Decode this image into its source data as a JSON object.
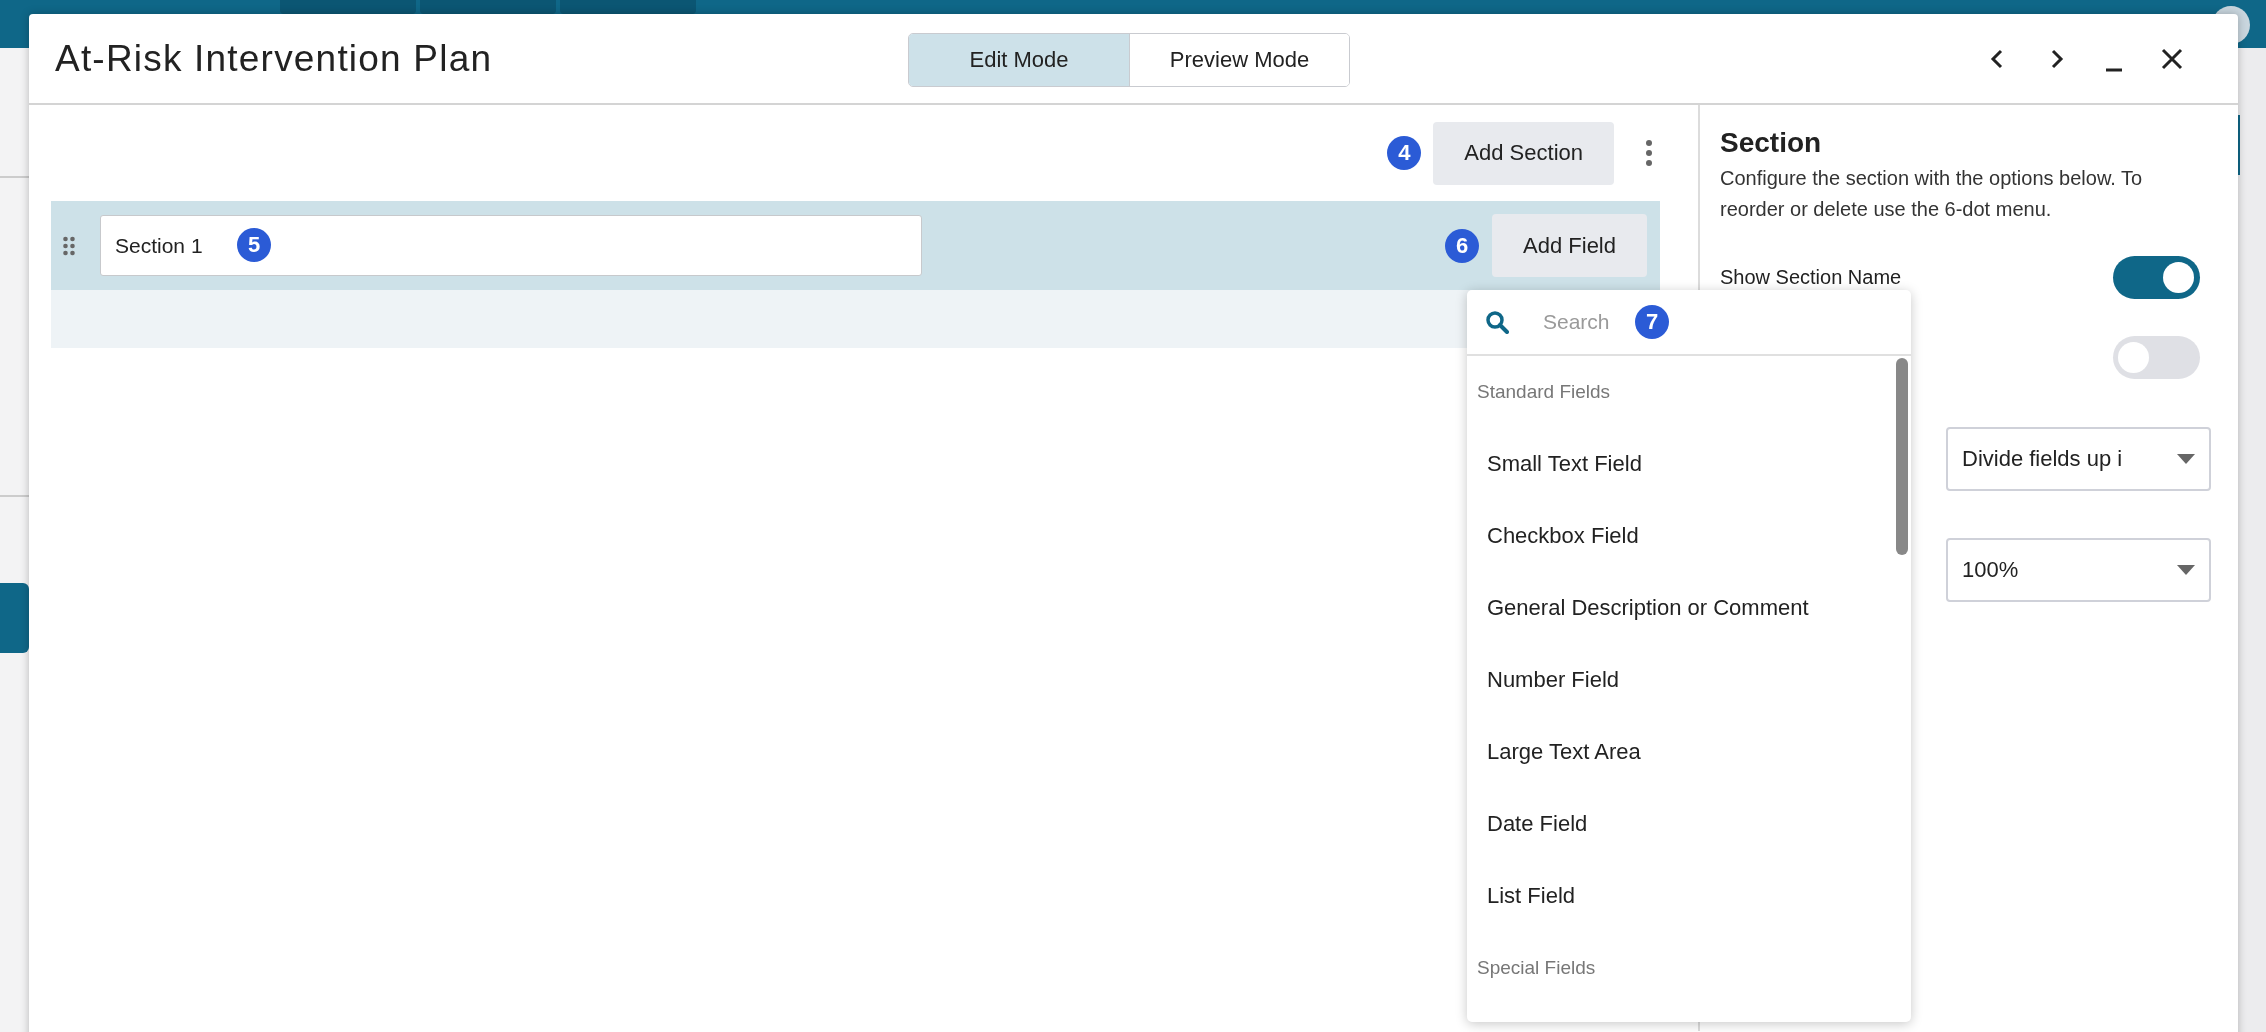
{
  "window": {
    "title": "At-Risk Intervention Plan"
  },
  "mode_tabs": [
    {
      "label": "Edit Mode",
      "selected": true
    },
    {
      "label": "Preview Mode",
      "selected": false
    }
  ],
  "toolbar": {
    "badge": "4",
    "add_section": "Add Section"
  },
  "sections": [
    {
      "name": "Section 1",
      "name_badge": "5",
      "field_badge": "6",
      "add_field": "Add Field"
    }
  ],
  "field_menu": {
    "placeholder": "Search",
    "badge": "7",
    "groups": [
      {
        "title": "Standard Fields",
        "items": [
          "Small Text Field",
          "Checkbox Field",
          "General Description or Comment",
          "Number Field",
          "Large Text Area",
          "Date Field",
          "List Field"
        ]
      },
      {
        "title": "Special Fields"
      }
    ]
  },
  "settings": {
    "title": "Section",
    "description": "Configure the section with the options below. To reorder or delete use the 6-dot menu.",
    "toggles": [
      {
        "label": "Show Section Name",
        "on": true
      },
      {
        "on": false
      }
    ],
    "selects": [
      {
        "value": "Divide fields up i"
      },
      {
        "value": "100%"
      }
    ]
  }
}
